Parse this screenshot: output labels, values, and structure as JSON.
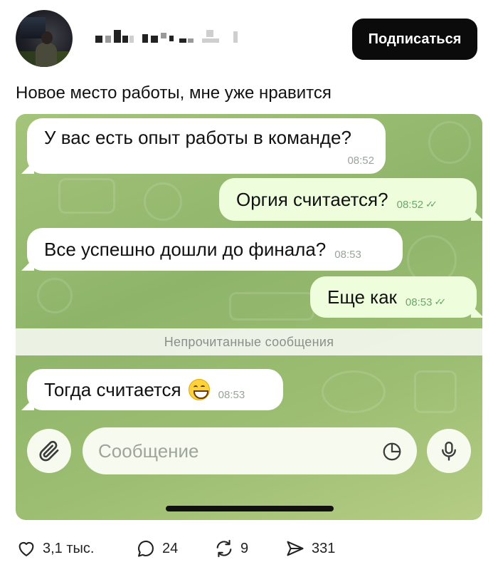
{
  "header": {
    "subscribe_label": "Подписаться"
  },
  "post": {
    "text": "Новое место работы, мне уже нравится"
  },
  "chat": {
    "messages": [
      {
        "text": "У вас есть опыт работы в команде?",
        "time": "08:52",
        "direction": "in"
      },
      {
        "text": "Оргия считается?",
        "time": "08:52",
        "direction": "out",
        "read": true
      },
      {
        "text": "Все успешно дошли до финала?",
        "time": "08:53",
        "direction": "in"
      },
      {
        "text": "Еще как",
        "time": "08:53",
        "direction": "out",
        "read": true
      },
      {
        "text": "Тогда считается",
        "time": "08:53",
        "direction": "in",
        "emoji": "grinning-face"
      }
    ],
    "unread_divider": "Непрочитанные сообщения",
    "input_placeholder": "Сообщение",
    "colors": {
      "background": "#9cbe72",
      "incoming_bubble": "#ffffff",
      "outgoing_bubble": "#eefedd",
      "read_ticks": "#5da35a"
    }
  },
  "actions": {
    "likes": "3,1 тыс.",
    "comments": "24",
    "reposts": "9",
    "shares": "331"
  }
}
